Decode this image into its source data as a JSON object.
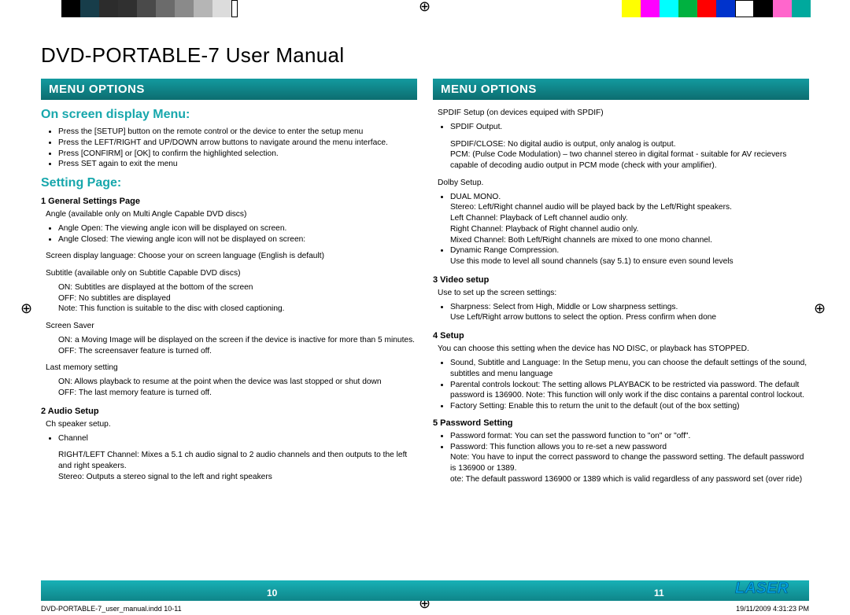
{
  "title": "DVD-PORTABLE-7 User Manual",
  "section_header_left": "MENU OPTIONS",
  "section_header_right": "MENU OPTIONS",
  "left": {
    "h1": "On screen display Menu:",
    "bullets1": [
      "Press the [SETUP] button on the remote control or the device to enter the setup menu",
      "Press the LEFT/RIGHT and UP/DOWN arrow buttons to navigate around the menu interface.",
      "Press [CONFIRM] or [OK] to confirm the highlighted selection.",
      "Press SET again to exit the menu"
    ],
    "h2": "Setting Page:",
    "s1_title": "1   General Settings Page",
    "s1_para1": "Angle (available only on Multi Angle Capable DVD discs)",
    "s1_bullets1": [
      "Angle Open: The viewing angle icon will be displayed on screen.",
      "Angle Closed: The viewing angle icon will not be displayed on screen:"
    ],
    "s1_para2": "Screen display language: Choose your on screen language (English is default)",
    "s1_para3": "Subtitle (available only on Subtitle Capable DVD discs)",
    "s1_indent1": "ON: Subtitles are displayed at the bottom of the screen",
    "s1_indent2": "OFF: No subtitles are displayed",
    "s1_indent3": "Note: This function is suitable to the disc with closed captioning.",
    "s1_para4": "Screen Saver",
    "s1_indent4": "ON: a Moving Image will be displayed on the screen if the device is inactive for more than 5 minutes.",
    "s1_indent5": "OFF: The screensaver feature is turned off.",
    "s1_para5": "Last memory setting",
    "s1_indent6": "ON: Allows playback to resume at the point when the device was last stopped or shut down",
    "s1_indent7": "OFF: The last memory feature is turned off.",
    "s2_title": "2   Audio Setup",
    "s2_para1": "Ch speaker setup.",
    "s2_bullets": [
      "Channel"
    ],
    "s2_indent1": "RIGHT/LEFT Channel: Mixes a 5.1 ch audio signal to 2 audio channels and then outputs to the left and right speakers.",
    "s2_indent2": "Stereo: Outputs a stereo signal to the left and right speakers"
  },
  "right": {
    "r_para1": "SPDIF Setup (on devices equiped with SPDIF)",
    "r_bullets1": [
      "SPDIF Output."
    ],
    "r_indent1": "SPDIF/CLOSE: No digital audio is output, only analog is output.",
    "r_indent2": "PCM: (Pulse Code Modulation) – two channel stereo in digital format - suitable for AV recievers capable of decoding audio output in PCM mode (check with your amplifier).",
    "r_para2": "Dolby Setup.",
    "r_bullets2": [
      "DUAL MONO."
    ],
    "r_indent3": "Stereo: Left/Right channel audio will be played back by the Left/Right speakers.",
    "r_indent4": "Left Channel: Playback of Left channel audio only.",
    "r_indent5": "Right Channel: Playback of Right channel audio only.",
    "r_indent6": "Mixed Channel: Both Left/Right channels are mixed to one mono channel.",
    "r_bullets3": [
      "Dynamic Range Compression."
    ],
    "r_indent7": "Use this mode to level all sound channels (say 5.1) to ensure even sound levels",
    "s3_title": "3   Video setup",
    "s3_para1": "Use to set up the screen settings:",
    "s3_bullets": [
      "Sharpness: Select from High, Middle or Low sharpness settings."
    ],
    "s3_indent1": "Use Left/Right arrow buttons to select the option. Press confirm when done",
    "s4_title": "4   Setup",
    "s4_para1": "You can choose this setting when the device has NO DISC, or playback has STOPPED.",
    "s4_bullets": [
      "Sound, Subtitle and Language: In the Setup menu, you can choose the default settings of the sound, subtitles and menu language",
      "Parental controls lockout: The setting allows PLAYBACK to be restricted via password. The default password is 136900. Note: This function will only work if the disc contains a parental control lockout.",
      "Factory Setting: Enable this to return the unit to the default (out of the box setting)"
    ],
    "s5_title": "5   Password Setting",
    "s5_bullets": [
      "Password format: You can set the password function to \"on\" or \"off\".",
      "Password: This function allows you to re-set a new password"
    ],
    "s5_indent1": "Note: You have to input the correct password to change the password setting. The default password is 136900 or 1389.",
    "s5_indent2": "ote: The default password 136900 or 1389 which is valid regardless of any password set (over ride)"
  },
  "page_left": "10",
  "page_right": "11",
  "meta_left": "DVD-PORTABLE-7_user_manual.indd   10-11",
  "meta_right": "19/11/2009   4:31:23 PM",
  "colorbar_left": [
    {
      "w": 28,
      "c": "#ffffff"
    },
    {
      "w": 24,
      "c": "#000000"
    },
    {
      "w": 24,
      "c": "#173d4a"
    },
    {
      "w": 24,
      "c": "#2c2c2c"
    },
    {
      "w": 24,
      "c": "#303030"
    },
    {
      "w": 24,
      "c": "#4a4a4a"
    },
    {
      "w": 24,
      "c": "#6b6b6b"
    },
    {
      "w": 24,
      "c": "#8a8a8a"
    },
    {
      "w": 24,
      "c": "#b5b5b5"
    },
    {
      "w": 24,
      "c": "#dcdcdc"
    },
    {
      "w": 8,
      "c": "#ffffff",
      "border": true
    }
  ],
  "colorbar_right": [
    {
      "w": 24,
      "c": "#ffff00"
    },
    {
      "w": 24,
      "c": "#ff00ff"
    },
    {
      "w": 24,
      "c": "#00ffff"
    },
    {
      "w": 24,
      "c": "#00b140"
    },
    {
      "w": 24,
      "c": "#ff0000"
    },
    {
      "w": 24,
      "c": "#0033cc"
    },
    {
      "w": 24,
      "c": "#ffffff",
      "border": true
    },
    {
      "w": 24,
      "c": "#000000"
    },
    {
      "w": 24,
      "c": "#ff66cc"
    },
    {
      "w": 24,
      "c": "#00a99d"
    }
  ]
}
